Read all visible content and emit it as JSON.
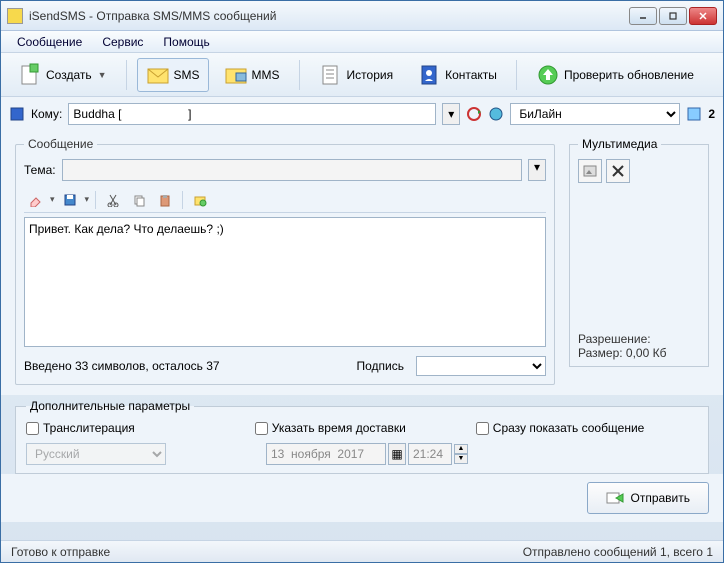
{
  "window": {
    "title": "iSendSMS - Отправка SMS/MMS сообщений"
  },
  "menu": {
    "message": "Сообщение",
    "service": "Сервис",
    "help": "Помощь"
  },
  "toolbar": {
    "create": "Создать",
    "sms": "SMS",
    "mms": "MMS",
    "history": "История",
    "contacts": "Контакты",
    "check_update": "Проверить обновление"
  },
  "recipient": {
    "label": "Кому:",
    "value": "Buddha [                    ]",
    "provider": "БиЛайн",
    "count": "2"
  },
  "message": {
    "legend": "Сообщение",
    "subject_label": "Тема:",
    "subject_value": "",
    "text": "Привет. Как дела? Что делаешь? ;)",
    "counter": "Введено 33 символов, осталось 37",
    "signature_label": "Подпись",
    "signature_value": ""
  },
  "multimedia": {
    "legend": "Мультимедиа",
    "resolution_label": "Разрешение:",
    "size_label": "Размер: 0,00 Кб"
  },
  "advanced": {
    "legend": "Дополнительные параметры",
    "translit": "Транслитерация",
    "schedule": "Указать время доставки",
    "show_now": "Сразу показать сообщение",
    "language": "Русский",
    "date": "13  ноября  2017",
    "time": "21:24"
  },
  "send_button": "Отправить",
  "status": {
    "left": "Готово к отправке",
    "right": "Отправлено сообщений 1, всего 1"
  }
}
